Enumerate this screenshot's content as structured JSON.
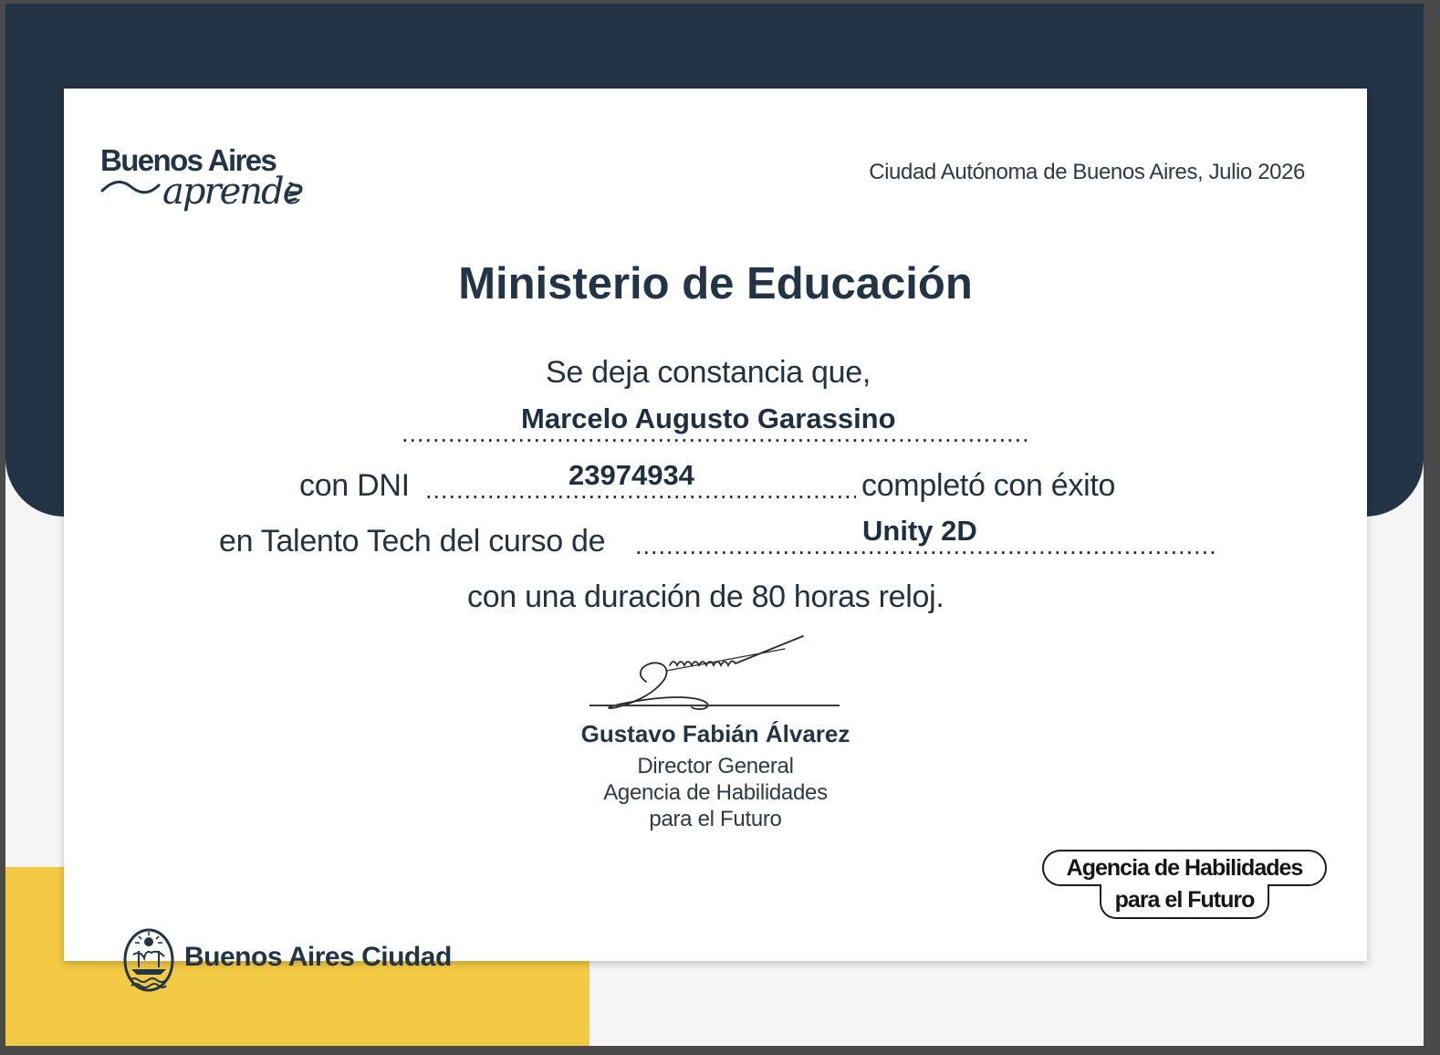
{
  "header": {
    "logo_line1": "Buenos Aires",
    "logo_line2": "aprende",
    "place_date": "Ciudad Autónoma de Buenos Aires, Julio 2026"
  },
  "title": "Ministerio de Educación",
  "intro": "Se deja constancia que,",
  "recipient": {
    "name": "Marcelo Augusto Garassino",
    "dni_label": "con DNI",
    "dni": "23974934",
    "completed_text": "completó con éxito"
  },
  "course": {
    "prefix": "en Talento Tech del curso de",
    "name": "Unity 2D",
    "duration_text": "con una duración de 80 horas reloj."
  },
  "signer": {
    "name": "Gustavo Fabián Álvarez",
    "role_line1": "Director General",
    "role_line2": "Agencia de Habilidades",
    "role_line3": "para el Futuro"
  },
  "agency_badge": {
    "line1": "Agencia de Habilidades",
    "line2": "para el Futuro"
  },
  "footer": {
    "city_brand": "Buenos Aires Ciudad"
  },
  "colors": {
    "navy": "#223446",
    "yellow": "#f2ca43",
    "paper": "#ffffff"
  }
}
